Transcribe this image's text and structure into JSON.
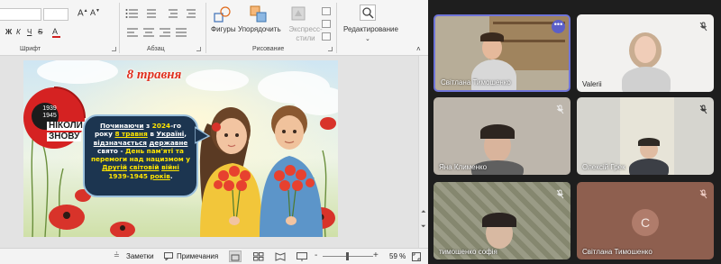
{
  "ribbon": {
    "group_font": "Шрифт",
    "group_paragraph": "Абзац",
    "group_drawing": "Рисование",
    "shapes_label": "Фигуры",
    "arrange_label": "Упорядочить",
    "quick_styles_label": "Экспресс-стили",
    "editing_label": "Редактирование",
    "bold": "Ж",
    "italic": "К",
    "underline": "Ч",
    "strike": "S",
    "text_color_letter": "А"
  },
  "slide": {
    "date_banner": "8 травня",
    "logo_years": "1939 1945",
    "logo_line1": "НІКОЛИ",
    "logo_line2": "ЗНОВУ",
    "text_segments": [
      {
        "text": "Починаючи",
        "color": "#ffffff",
        "underline": true
      },
      {
        "text": " з ",
        "color": "#ffffff",
        "underline": false
      },
      {
        "text": "2024",
        "color": "#ffe500",
        "underline": false
      },
      {
        "text": "-го року ",
        "color": "#ffffff",
        "underline": false
      },
      {
        "text": "8 травня",
        "color": "#ffe500",
        "underline": true
      },
      {
        "text": " в ",
        "color": "#ffffff",
        "underline": false
      },
      {
        "text": "Україні",
        "color": "#ffffff",
        "underline": true
      },
      {
        "text": ", ",
        "color": "#ffffff",
        "underline": false
      },
      {
        "text": "відзначається",
        "color": "#ffffff",
        "underline": true
      },
      {
        "text": " ",
        "color": "#ffffff",
        "underline": false
      },
      {
        "text": "державне",
        "color": "#ffffff",
        "underline": true
      },
      {
        "text": " свято - ",
        "color": "#ffffff",
        "underline": false
      },
      {
        "text": "День пам'яті та перемоги над нацизмом у",
        "color": "#ffe500",
        "underline": false
      },
      {
        "text": " ",
        "color": "#ffffff",
        "underline": false
      },
      {
        "text": "Другій",
        "color": "#ffe500",
        "underline": true
      },
      {
        "text": " ",
        "color": "#ffffff",
        "underline": false
      },
      {
        "text": "світовій",
        "color": "#ffe500",
        "underline": true
      },
      {
        "text": " ",
        "color": "#ffffff",
        "underline": false
      },
      {
        "text": "війні",
        "color": "#ffe500",
        "underline": true
      },
      {
        "text": " 1939-1945 ",
        "color": "#ffe500",
        "underline": false
      },
      {
        "text": "років",
        "color": "#ffe500",
        "underline": true
      },
      {
        "text": ".",
        "color": "#ffffff",
        "underline": false
      }
    ]
  },
  "statusbar": {
    "notes_label": "Заметки",
    "comments_label": "Примечания",
    "zoom": "59 %",
    "zoom_minus": "-",
    "zoom_plus": "+"
  },
  "participants": [
    {
      "name": "Світлана Тимошенко",
      "muted": false,
      "avatar_letter": ""
    },
    {
      "name": "Valerii",
      "muted": true,
      "avatar_letter": ""
    },
    {
      "name": "Яна Клименко",
      "muted": true,
      "avatar_letter": ""
    },
    {
      "name": "Олексій Грек",
      "muted": true,
      "avatar_letter": ""
    },
    {
      "name": "тимошенко софія",
      "muted": true,
      "avatar_letter": ""
    },
    {
      "name": "Світлана Тимошенко",
      "muted": true,
      "avatar_letter": "С"
    }
  ],
  "more_options_icon": "more-dots",
  "colors": {
    "accent": "#5b5fc7",
    "muted_mic": "#e8e8e8",
    "active_mic": "#d34040",
    "slide_red": "#d52222",
    "caption_box": "#1c3550"
  }
}
